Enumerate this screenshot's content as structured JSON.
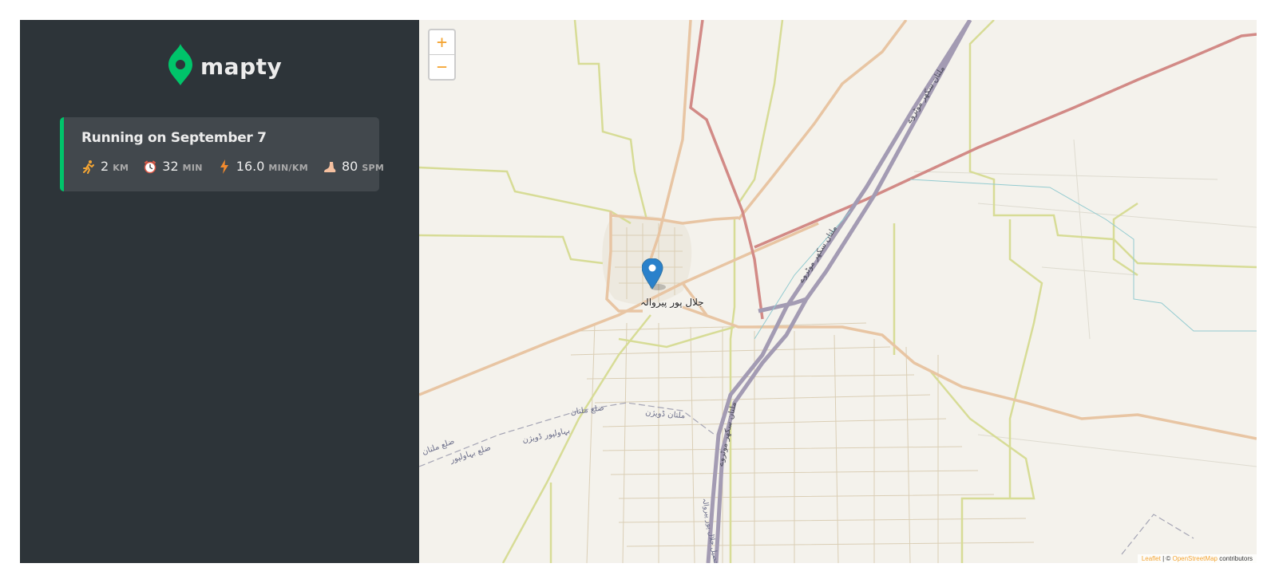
{
  "logo": {
    "text": "mapty",
    "icon": "map-pin-icon",
    "brand_color": "#00c46a"
  },
  "workouts": [
    {
      "title": "Running on September 7",
      "type": "running",
      "accent_color": "#00c46a",
      "details": [
        {
          "icon": "runner-icon",
          "value": "2",
          "unit": "KM"
        },
        {
          "icon": "stopwatch-icon",
          "value": "32",
          "unit": "MIN"
        },
        {
          "icon": "lightning-icon",
          "value": "16.0",
          "unit": "MIN/KM"
        },
        {
          "icon": "foot-icon",
          "value": "80",
          "unit": "SPM"
        }
      ]
    }
  ],
  "map": {
    "zoom_in_label": "+",
    "zoom_out_label": "−",
    "place_label": "جلال پور پیروالہ",
    "marker_color": "#2a81cb",
    "road_labels": {
      "motorway_1": "ملتان سکھر موٹروے",
      "motorway_2": "ملتان سکھر موٹروے",
      "motorway_3": "ملتان سکھر موٹروے",
      "district_multan_1": "ضلع ملتان",
      "district_multan_2": "ضلع ملتان",
      "division_multan": "ملتان ڈویژن",
      "division_bahawalpur": "بہاولپور ڈویژن",
      "district_bahawalpur": "ضلع بہاولپور",
      "tehsil": "تحصیل جلال پور پیروالہ"
    },
    "attribution": {
      "leaflet": "Leaflet",
      "separator": " | © ",
      "osm": "OpenStreetMap",
      "suffix": " contributors"
    }
  }
}
